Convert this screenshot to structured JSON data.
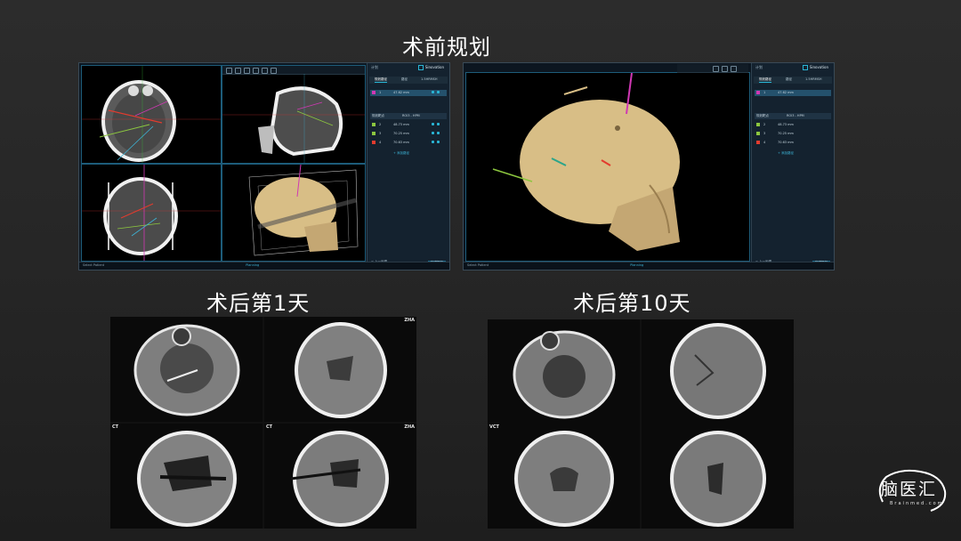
{
  "titles": {
    "preop": "术前规划",
    "day1": "术后第1天",
    "day10": "术后第10天"
  },
  "software": {
    "brand": "Sinovation",
    "header_left": "计划",
    "tabs": [
      "规划路径",
      "路径",
      "1.5HRMSH"
    ],
    "rows": [
      {
        "color": "#d038b4",
        "label": "1",
        "value": "47.62 mm"
      },
      {
        "color": "#8cc63f",
        "label": "2",
        "value": "48.73 mm"
      },
      {
        "color": "#8cc63f",
        "label": "3",
        "value": "70.25 mm"
      },
      {
        "color": "#e23b2e",
        "label": "4",
        "value": "70.63 mm"
      }
    ],
    "mid_row": "规划靶点",
    "mid_row_value": "ROI3 - HPM",
    "add_link": "+ 添加路径",
    "footer": "< 上一步骤",
    "footer_btn": "完成规划",
    "status_left": "Select Patient",
    "status_center": "Planning",
    "panel_icons": [
      "eye-icon",
      "lock-icon",
      "trash-icon"
    ]
  },
  "ct_labels": {
    "patient": "ZHA",
    "modality": "CT",
    "modality_v": "VCT"
  },
  "logo": {
    "name": "脑医汇",
    "url": "Brainmed.com"
  },
  "colors": {
    "background": "#262626",
    "accent": "#29b6d6",
    "path_magenta": "#d038b4",
    "path_green": "#8cc63f",
    "path_red": "#e23b2e",
    "bone": "#d8be86"
  }
}
